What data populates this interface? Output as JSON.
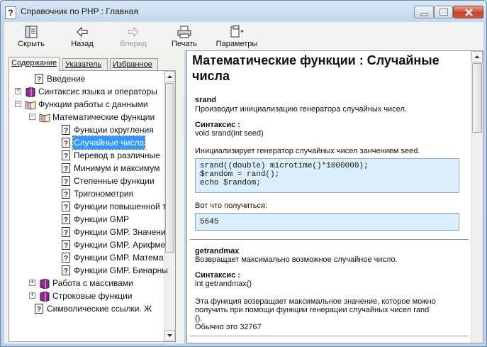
{
  "window": {
    "title": "Справочник по PHP : Главная",
    "app_icon_glyph": "?"
  },
  "toolbar": [
    {
      "id": "hide",
      "label": "Скрыть",
      "icon": "hide-pane-icon",
      "enabled": true
    },
    {
      "id": "back",
      "label": "Назад",
      "icon": "back-arrow-icon",
      "enabled": true
    },
    {
      "id": "forward",
      "label": "Вперед",
      "icon": "forward-arrow-icon",
      "enabled": false
    },
    {
      "id": "print",
      "label": "Печать",
      "icon": "printer-icon",
      "enabled": true
    },
    {
      "id": "options",
      "label": "Параметры",
      "icon": "options-icon",
      "enabled": true
    }
  ],
  "nav_tabs": [
    {
      "label": "Содержание",
      "active": true
    },
    {
      "label": "Указатель",
      "active": false
    },
    {
      "label": "Избранное",
      "active": false
    }
  ],
  "tree": [
    {
      "label": "Введение",
      "icon": "help-page-icon",
      "level": 1,
      "expander": ""
    },
    {
      "label": "Синтаксис языка и операторы",
      "icon": "book-closed-icon",
      "level": 0,
      "expander": "+"
    },
    {
      "label": "Функции работы с данными",
      "icon": "book-open-icon",
      "level": 0,
      "expander": "−"
    },
    {
      "label": "Математические функции",
      "icon": "book-open-icon",
      "level": 1,
      "expander": "−"
    },
    {
      "label": "Функции округления",
      "icon": "help-page-icon",
      "level": 2,
      "expander": ""
    },
    {
      "label": "Случайные числа",
      "icon": "help-page-icon",
      "level": 2,
      "expander": "",
      "selected": true
    },
    {
      "label": "Перевод в различные",
      "icon": "help-page-icon",
      "level": 2,
      "expander": ""
    },
    {
      "label": "Минимум и максимум",
      "icon": "help-page-icon",
      "level": 2,
      "expander": ""
    },
    {
      "label": "Степенные функции",
      "icon": "help-page-icon",
      "level": 2,
      "expander": ""
    },
    {
      "label": "Тригонометрия",
      "icon": "help-page-icon",
      "level": 2,
      "expander": ""
    },
    {
      "label": "Функции повышенной т",
      "icon": "help-page-icon",
      "level": 2,
      "expander": ""
    },
    {
      "label": "Функции GMP",
      "icon": "help-page-icon",
      "level": 2,
      "expander": ""
    },
    {
      "label": "Функции GMP. Значени",
      "icon": "help-page-icon",
      "level": 2,
      "expander": ""
    },
    {
      "label": "Функции GMP. Арифме",
      "icon": "help-page-icon",
      "level": 2,
      "expander": ""
    },
    {
      "label": "Функции GMP. Матема",
      "icon": "help-page-icon",
      "level": 2,
      "expander": ""
    },
    {
      "label": "Функции GMP. Бинарны",
      "icon": "help-page-icon",
      "level": 2,
      "expander": ""
    },
    {
      "label": "Работа с массивами",
      "icon": "book-closed-icon",
      "level": 1,
      "expander": "+"
    },
    {
      "label": "Строковые функции",
      "icon": "book-closed-icon",
      "level": 1,
      "expander": "+"
    },
    {
      "label": "Символические ссылки. Ж",
      "icon": "help-page-icon",
      "level": 1,
      "expander": ""
    }
  ],
  "content": {
    "title": "Математические функции : Случайные числа",
    "sections": [
      {
        "name": "srand",
        "desc": "Производит инициализацию генератора случайных чисел.",
        "syntax_label": "Синтаксис :",
        "syntax": "void srand(int seed)",
        "body": [
          "Инициализирует генератор случайных чисел занчением seed."
        ],
        "code": [
          "srand((double) microtime()*1000000);",
          "$random = rand();",
          "echo $random;"
        ],
        "result_label": "Вот что получиться:",
        "result": [
          "5645"
        ]
      },
      {
        "name": "getrandmax",
        "desc": "Возвращает максимально возможное случайное число.",
        "syntax_label": "Синтаксис :",
        "syntax": "int getrandmax()",
        "body": [
          "Эта функция возвращает максимальное значение, которое можно",
          "получить при помощи функции генерации случайных чисел rand",
          "().",
          "Обычно это 32767"
        ]
      }
    ]
  }
}
